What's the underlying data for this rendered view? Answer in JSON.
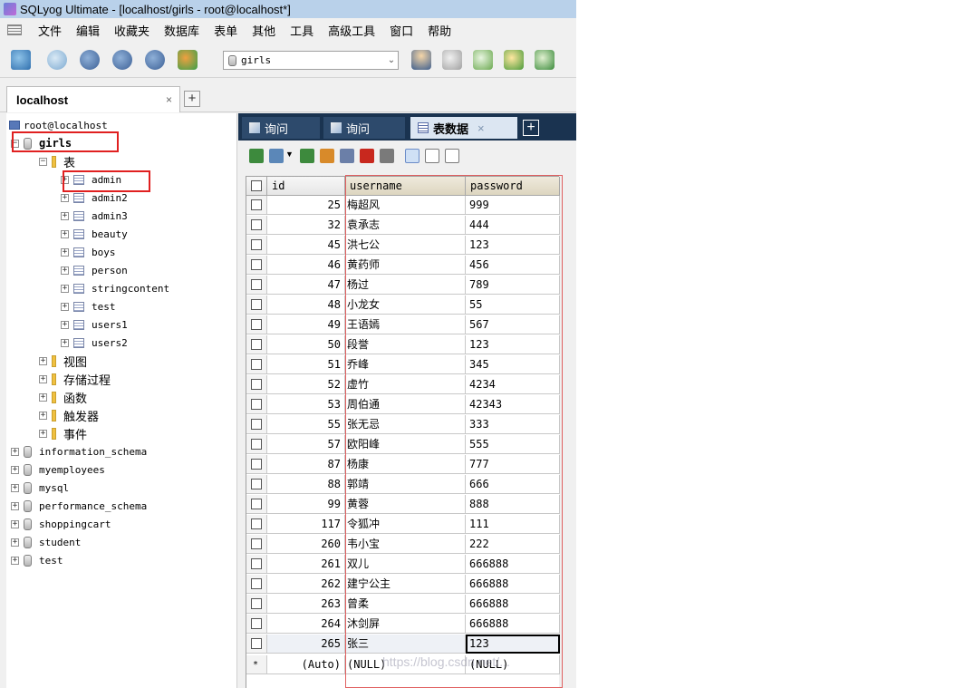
{
  "window": {
    "title": "SQLyog Ultimate - [localhost/girls - root@localhost*]"
  },
  "menu": [
    "文件",
    "编辑",
    "收藏夹",
    "数据库",
    "表单",
    "其他",
    "工具",
    "高级工具",
    "窗口",
    "帮助"
  ],
  "toolbar": {
    "db_selector": "girls"
  },
  "connection_tab": {
    "label": "localhost",
    "close": "×",
    "add": "+"
  },
  "tree": {
    "root": "root@localhost",
    "selected_db": "girls",
    "tables_folder": "表",
    "tables": [
      "admin",
      "admin2",
      "admin3",
      "beauty",
      "boys",
      "person",
      "stringcontent",
      "test",
      "users1",
      "users2"
    ],
    "folders": [
      "视图",
      "存储过程",
      "函数",
      "触发器",
      "事件"
    ],
    "databases": [
      "information_schema",
      "myemployees",
      "mysql",
      "performance_schema",
      "shoppingcart",
      "student",
      "test"
    ]
  },
  "query_tabs": [
    {
      "label": "询问"
    },
    {
      "label": "询问"
    },
    {
      "label": "表数据",
      "close": "×"
    }
  ],
  "grid": {
    "columns": [
      "id",
      "username",
      "password"
    ],
    "rows": [
      [
        "25",
        "梅超风",
        "999"
      ],
      [
        "32",
        "袁承志",
        "444"
      ],
      [
        "45",
        "洪七公",
        "123"
      ],
      [
        "46",
        "黄药师",
        "456"
      ],
      [
        "47",
        "杨过",
        "789"
      ],
      [
        "48",
        "小龙女",
        "55"
      ],
      [
        "49",
        "王语嫣",
        "567"
      ],
      [
        "50",
        "段誉",
        "123"
      ],
      [
        "51",
        "乔峰",
        "345"
      ],
      [
        "52",
        "虚竹",
        "4234"
      ],
      [
        "53",
        "周伯通",
        "42343"
      ],
      [
        "55",
        "张无忌",
        "333"
      ],
      [
        "57",
        "欧阳峰",
        "555"
      ],
      [
        "87",
        "杨康",
        "777"
      ],
      [
        "88",
        "郭靖",
        "666"
      ],
      [
        "99",
        "黄蓉",
        "888"
      ],
      [
        "117",
        "令狐冲",
        "111"
      ],
      [
        "260",
        "韦小宝",
        "222"
      ],
      [
        "261",
        "双儿",
        "666888"
      ],
      [
        "262",
        "建宁公主",
        "666888"
      ],
      [
        "263",
        "曾柔",
        "666888"
      ],
      [
        "264",
        "沐剑屏",
        "666888"
      ],
      [
        "265",
        "张三",
        "123"
      ]
    ],
    "new_row": {
      "marker": "*",
      "id": "(Auto)",
      "username": "(NULL)",
      "password": "(NULL)"
    }
  },
  "watermark": "https://blog.csdn.net/...",
  "colors": {
    "titlebar": "#b9d1ea",
    "tab_strip": "#1a3350",
    "highlight_box": "#e02020"
  }
}
